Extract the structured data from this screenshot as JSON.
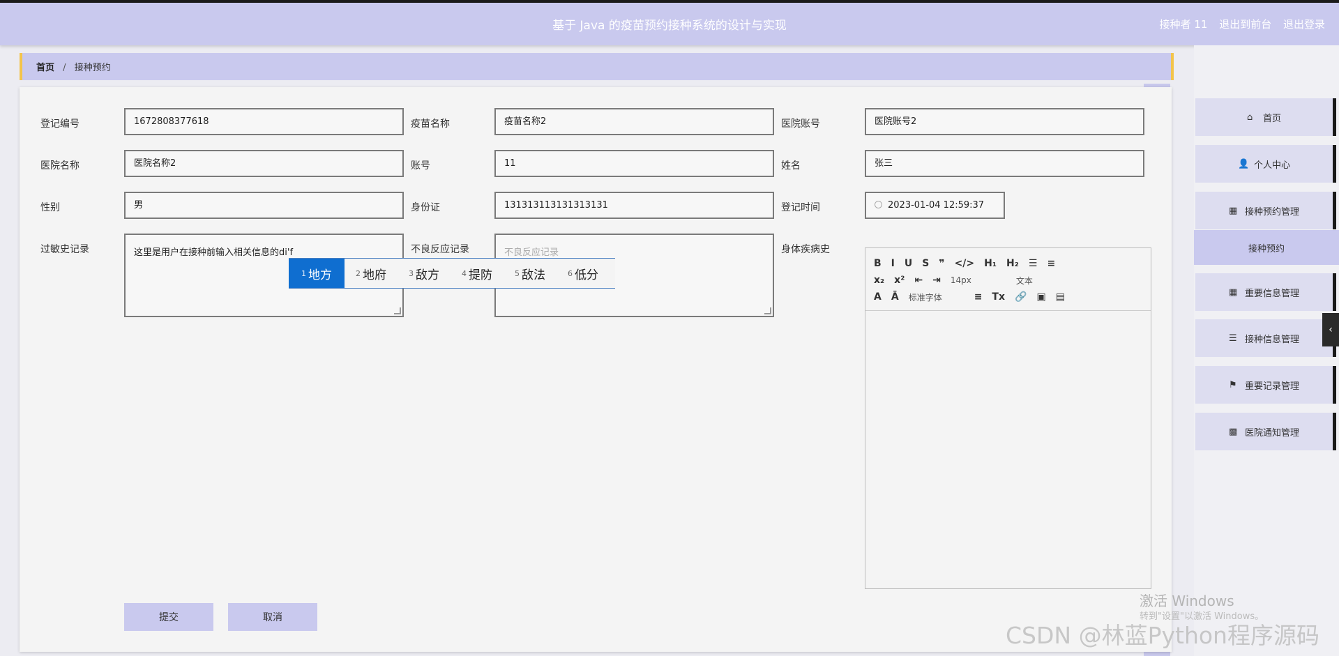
{
  "header": {
    "title": "基于 Java 的疫苗预约接种系统的设计与实现",
    "user": "接种者 11",
    "front_link": "退出到前台",
    "logout": "退出登录"
  },
  "breadcrumb": {
    "home": "首页",
    "separator": "/",
    "current": "接种预约"
  },
  "form": {
    "reg_no_label": "登记编号",
    "reg_no_value": "1672808377618",
    "vaccine_name_label": "疫苗名称",
    "vaccine_name_value": "疫苗名称2",
    "hospital_account_label": "医院账号",
    "hospital_account_value": "医院账号2",
    "hospital_name_label": "医院名称",
    "hospital_name_value": "医院名称2",
    "account_label": "账号",
    "account_value": "11",
    "name_label": "姓名",
    "name_value": "张三",
    "gender_label": "性别",
    "gender_value": "男",
    "id_card_label": "身份证",
    "id_card_value": "131313113131313131",
    "reg_time_label": "登记时间",
    "reg_time_value": "2023-01-04 12:59:37",
    "allergy_label": "过敏史记录",
    "allergy_value": "这里是用户在接种前输入相关信息的di'f",
    "adverse_label": "不良反应记录",
    "adverse_placeholder": "不良反应记录",
    "disease_label": "身体疾病史"
  },
  "editor": {
    "row1": [
      "B",
      "I",
      "U",
      "S",
      "❞",
      "</>",
      "H₁",
      "H₂",
      "☰",
      "≡"
    ],
    "row2": [
      "x₂",
      "x²",
      "⇤",
      "⇥"
    ],
    "font_size": "14px",
    "text_type": "文本",
    "row3": [
      "A",
      "Ā"
    ],
    "font_family": "标准字体",
    "row3b": [
      "≡",
      "Tx",
      "🔗",
      "▣",
      "▤"
    ]
  },
  "ime": {
    "candidates": [
      {
        "num": "1",
        "text": "地方"
      },
      {
        "num": "2",
        "text": "地府"
      },
      {
        "num": "3",
        "text": "敌方"
      },
      {
        "num": "4",
        "text": "提防"
      },
      {
        "num": "5",
        "text": "敌法"
      },
      {
        "num": "6",
        "text": "低分"
      }
    ]
  },
  "buttons": {
    "submit": "提交",
    "cancel": "取消"
  },
  "sidebar": {
    "items": [
      {
        "label": "首页",
        "icon": "home-icon"
      },
      {
        "label": "个人中心",
        "icon": "user-icon"
      },
      {
        "label": "接种预约管理",
        "icon": "grid-icon"
      },
      {
        "label": "接种预约",
        "icon": ""
      },
      {
        "label": "重要信息管理",
        "icon": "grid-icon"
      },
      {
        "label": "接种信息管理",
        "icon": "list-icon"
      },
      {
        "label": "重要记录管理",
        "icon": "flag-icon"
      },
      {
        "label": "医院通知管理",
        "icon": "apps-icon"
      }
    ],
    "collapse": "‹"
  },
  "watermarks": {
    "windows_title": "激活 Windows",
    "windows_sub": "转到\"设置\"以激活 Windows。",
    "csdn": "CSDN @林蓝Python程序源码"
  }
}
